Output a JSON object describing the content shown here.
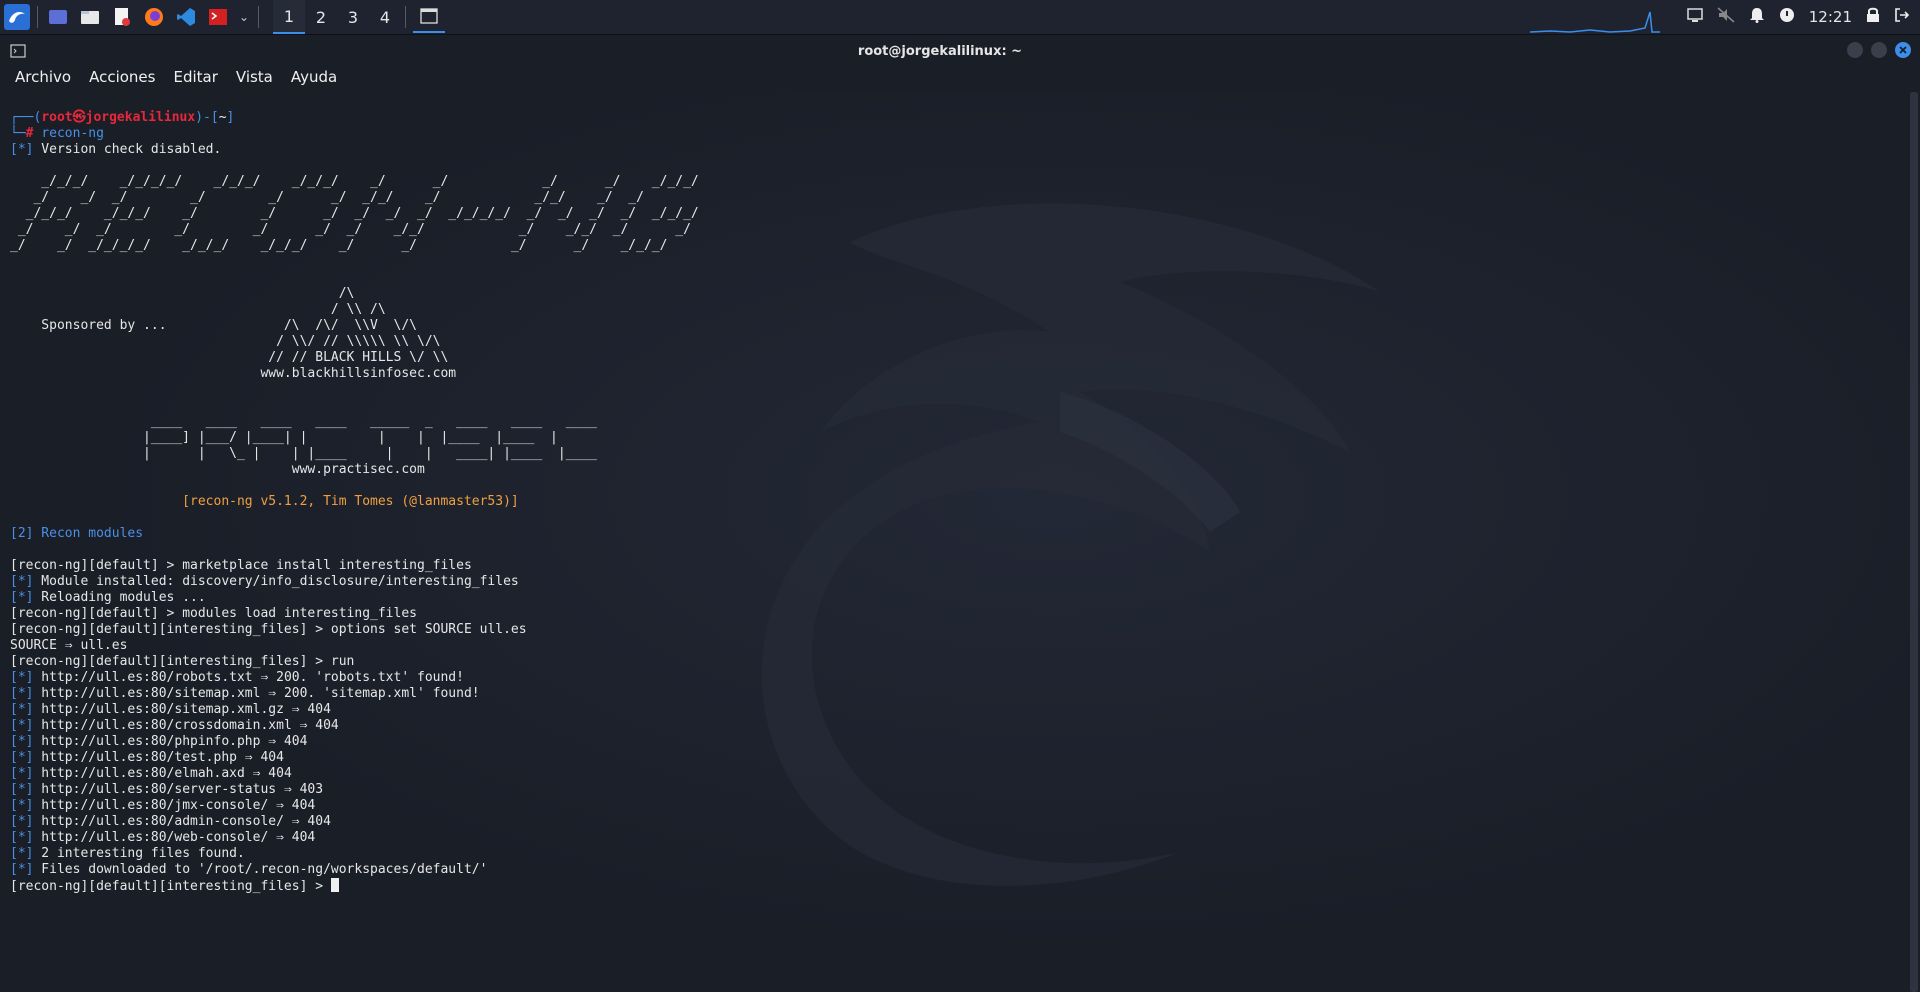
{
  "taskbar": {
    "workspaces": [
      "1",
      "2",
      "3",
      "4"
    ],
    "active_workspace": "1",
    "clock": "12:21",
    "icons": [
      "kali-menu-icon",
      "desktop-icon",
      "file-manager-icon",
      "text-editor-icon",
      "firefox-icon",
      "vscode-icon",
      "terminal-red-icon",
      "chevron-down-icon"
    ]
  },
  "window": {
    "title": "root@jorgekalilinux: ~"
  },
  "menu": {
    "items": [
      "Archivo",
      "Acciones",
      "Editar",
      "Vista",
      "Ayuda"
    ]
  },
  "terminal": {
    "prompt_user": "root㉿jorgekalilinux",
    "prompt_dir": "~",
    "first_command": "recon-ng",
    "version_check": "Version check disabled.",
    "banner": [
      "    _/_/_/    _/_/_/_/    _/_/_/    _/_/_/    _/      _/            _/      _/    _/_/_/",
      "   _/    _/  _/        _/        _/      _/  _/_/    _/            _/_/    _/  _/",
      "  _/_/_/    _/_/_/    _/        _/      _/  _/  _/  _/  _/_/_/_/  _/  _/  _/  _/  _/_/_/",
      " _/    _/  _/        _/        _/      _/  _/    _/_/            _/    _/_/  _/      _/",
      "_/    _/  _/_/_/_/    _/_/_/    _/_/_/    _/      _/            _/      _/    _/_/_/"
    ],
    "sponsor_label": "Sponsored by ...",
    "bhis_art": [
      "                                          /\\",
      "                                         / \\\\ /\\",
      "    Sponsored by ...               /\\  /\\/  \\\\V  \\/\\",
      "                                  / \\\\/ // \\\\\\\\\\ \\\\ \\/\\",
      "                                 // // BLACK HILLS \\/ \\\\",
      "                                www.blackhillsinfosec.com"
    ],
    "practisec_art": [
      "                  ____   ____   ____   ____   _____  _   ____   ____   ____",
      "                 |____] |___/ |____| |         |    |  |____  |____  |",
      "                 |      |   \\_ |    | |____     |    |   ____| |____  |____"
    ],
    "practisec_url": "www.practisec.com",
    "version_line": "[recon-ng v5.1.2, Tim Tomes (@lanmaster53)]",
    "modules_count": "[2] Recon modules",
    "session": [
      {
        "t": "cmd",
        "prompt": "[recon-ng][default] > ",
        "text": "marketplace install interesting_files"
      },
      {
        "t": "info",
        "text": "Module installed: discovery/info_disclosure/interesting_files"
      },
      {
        "t": "info",
        "text": "Reloading modules ..."
      },
      {
        "t": "cmd",
        "prompt": "[recon-ng][default] > ",
        "text": "modules load interesting_files"
      },
      {
        "t": "cmd",
        "prompt": "[recon-ng][default][interesting_files] > ",
        "text": "options set SOURCE ull.es"
      },
      {
        "t": "plain",
        "text": "SOURCE ⇒ ull.es"
      },
      {
        "t": "cmd",
        "prompt": "[recon-ng][default][interesting_files] > ",
        "text": "run"
      },
      {
        "t": "info",
        "text": "http://ull.es:80/robots.txt ⇒ 200. 'robots.txt' found!"
      },
      {
        "t": "info",
        "text": "http://ull.es:80/sitemap.xml ⇒ 200. 'sitemap.xml' found!"
      },
      {
        "t": "info",
        "text": "http://ull.es:80/sitemap.xml.gz ⇒ 404"
      },
      {
        "t": "info",
        "text": "http://ull.es:80/crossdomain.xml ⇒ 404"
      },
      {
        "t": "info",
        "text": "http://ull.es:80/phpinfo.php ⇒ 404"
      },
      {
        "t": "info",
        "text": "http://ull.es:80/test.php ⇒ 404"
      },
      {
        "t": "info",
        "text": "http://ull.es:80/elmah.axd ⇒ 404"
      },
      {
        "t": "info",
        "text": "http://ull.es:80/server-status ⇒ 403"
      },
      {
        "t": "info",
        "text": "http://ull.es:80/jmx-console/ ⇒ 404"
      },
      {
        "t": "info",
        "text": "http://ull.es:80/admin-console/ ⇒ 404"
      },
      {
        "t": "info",
        "text": "http://ull.es:80/web-console/ ⇒ 404"
      },
      {
        "t": "info",
        "text": "2 interesting files found."
      },
      {
        "t": "info",
        "text": "Files downloaded to '/root/.recon-ng/workspaces/default/'"
      }
    ],
    "info_tag": "[*]",
    "final_prompt": "[recon-ng][default][interesting_files] > "
  }
}
